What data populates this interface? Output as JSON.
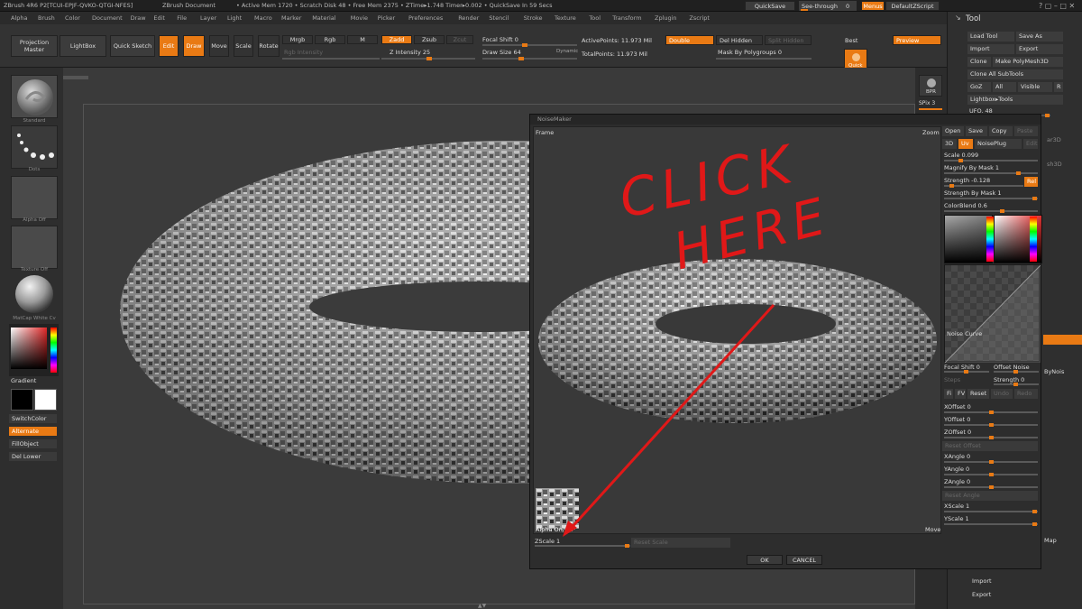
{
  "titlebar": {
    "app": "ZBrush 4R6 P2[TCUI-EPJF-QVKO-QTGI-NFES]",
    "doc": "ZBrush Document",
    "stats": "• Active Mem 1720 • Scratch Disk 48 • Free Mem 2375 • ZTime▸1.748 Timer▸0.002 • QuickSave In 59 Secs",
    "quicksave": "QuickSave",
    "seethrough": "See-through",
    "seethrough_val": "0",
    "menus": "Menus",
    "script": "DefaultZScript"
  },
  "menubar": [
    "Alpha",
    "Brush",
    "Color",
    "Document",
    "Draw",
    "Edit",
    "File",
    "Layer",
    "Light",
    "Macro",
    "Marker",
    "Material",
    "Movie",
    "Picker",
    "Preferences",
    "Render",
    "Stencil",
    "Stroke",
    "Texture",
    "Tool",
    "Transform",
    "Zplugin",
    "Zscript"
  ],
  "toolbar": {
    "projection_master": "Projection Master",
    "lightbox": "LightBox",
    "quick_sketch": "Quick Sketch",
    "edit": "Edit",
    "draw": "Draw",
    "move": "Move",
    "scale": "Scale",
    "rotate": "Rotate",
    "mrgb": "Mrgb",
    "rgb": "Rgb",
    "m": "M",
    "zadd": "Zadd",
    "zsub": "Zsub",
    "zcut": "Zcut",
    "rgb_intensity": "Rgb Intensity",
    "z_intensity": "Z Intensity 25",
    "focal_shift": "Focal Shift 0",
    "draw_size": "Draw Size 64",
    "dynamic": "Dynamic",
    "active_points": "ActivePoints: 11.973 Mil",
    "total_points": "TotalPoints: 11.973 Mil",
    "double": "Double",
    "del_hidden": "Del Hidden",
    "split_hidden": "Split Hidden",
    "mask_by_polygroups": "Mask By Polygroups 0",
    "best": "Best",
    "quick": "Quick",
    "preview": "Preview"
  },
  "leftshelf": {
    "standard": "Standard",
    "dots": "Dots",
    "alpha_off": "Alpha Off",
    "texture_off": "Texture Off",
    "matcap": "MatCap White Cv",
    "gradient": "Gradient",
    "switchcolor": "SwitchColor",
    "alternate": "Alternate",
    "fillobject": "FillObject",
    "del_lower": "Del Lower"
  },
  "rightshelf": {
    "bpr": "BPR",
    "spix": "SPix 3"
  },
  "toolpanel": {
    "title": "Tool",
    "load_tool": "Load Tool",
    "save_as": "Save As",
    "import": "Import",
    "export": "Export",
    "clone": "Clone",
    "make_polymesh": "Make PolyMesh3D",
    "clone_all_subtools": "Clone All SubTools",
    "goz": "GoZ",
    "all": "All",
    "visible": "Visible",
    "r": "R",
    "lightbox_tools": "Lightbox▸Tools",
    "ufo": "UFO. 48",
    "ar3d": "ar3D",
    "sh3d": "sh3D",
    "bynois": "ByNois",
    "map": "Map",
    "import2": "Import",
    "export2": "Export"
  },
  "noisemaker": {
    "title": "NoiseMaker",
    "frame": "Frame",
    "zoom": "Zoom",
    "move": "Move",
    "alpha_onoff": "Alpha On/Off",
    "zscale": "ZScale 1",
    "reset_scale": "Reset Scale",
    "ok": "OK",
    "cancel": "CANCEL",
    "annotation_1": "CLICK",
    "annotation_2": "HERE",
    "open": "Open",
    "save": "Save",
    "copy": "Copy",
    "paste": "Paste",
    "b3d": "3D",
    "uv": "Uv",
    "noiseplug": "NoisePlug",
    "edit": "Edit",
    "scale": "Scale 0.099",
    "magnify_by_mask": "Magnify By Mask 1",
    "strength": "Strength -0.128",
    "rel": "Rel",
    "strength_by_mask": "Strength By Mask 1",
    "colorblend": "ColorBlend 0.6",
    "noise_curve": "Noise Curve",
    "focal_shift": "Focal Shift 0",
    "offset_noise": "Offset Noise",
    "steps": "Steps",
    "strength2": "Strength 0",
    "fi": "Fi",
    "fv": "FV",
    "reset": "Reset",
    "undo": "Undo",
    "redo": "Redo",
    "xoffset": "XOffset 0",
    "yoffset": "YOffset 0",
    "zoffset": "ZOffset 0",
    "reset_offset": "Reset Offset",
    "xangle": "XAngle 0",
    "yangle": "YAngle 0",
    "zangle": "ZAngle 0",
    "reset_angle": "Reset Angle",
    "xscale": "XScale 1",
    "yscale": "YScale 1"
  },
  "colors": {
    "accent": "#e97a14",
    "annotation": "#e01818",
    "panel": "#2f2f2f"
  }
}
